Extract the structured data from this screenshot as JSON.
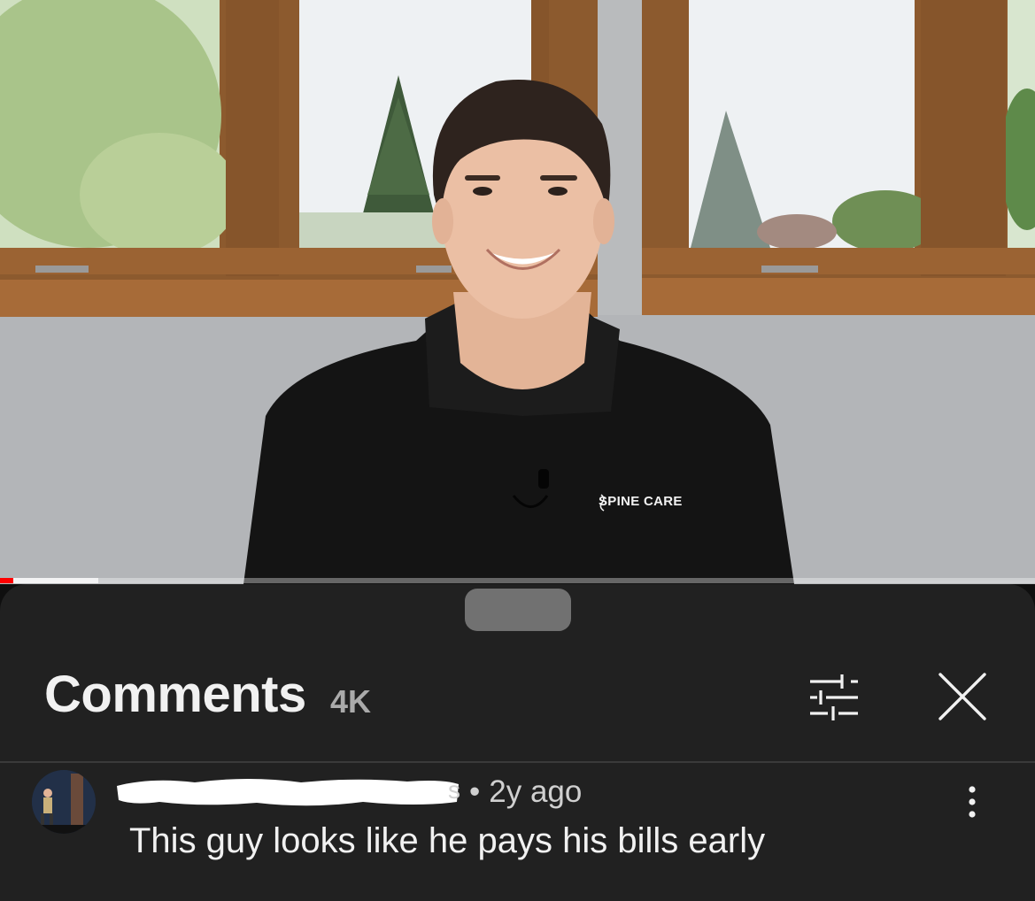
{
  "video": {
    "shirt_logo": "SPINE CARE",
    "progress": {
      "played_fraction": 0.013,
      "buffered_fraction": 0.095,
      "played_color": "#ff0000"
    }
  },
  "comments_sheet": {
    "title": "Comments",
    "count": "4K",
    "filter_icon": "sort-filter-icon",
    "close_icon": "close-icon",
    "comments": [
      {
        "avatar_icon": "user-avatar",
        "author": "",
        "separator": "•",
        "time": "2y ago",
        "text": "This guy looks like he pays his bills early",
        "menu_icon": "more-vertical-icon"
      }
    ]
  },
  "colors": {
    "sheet_bg": "#212121",
    "title_text": "#f1f1f1",
    "muted_text": "#aaaaaa"
  }
}
